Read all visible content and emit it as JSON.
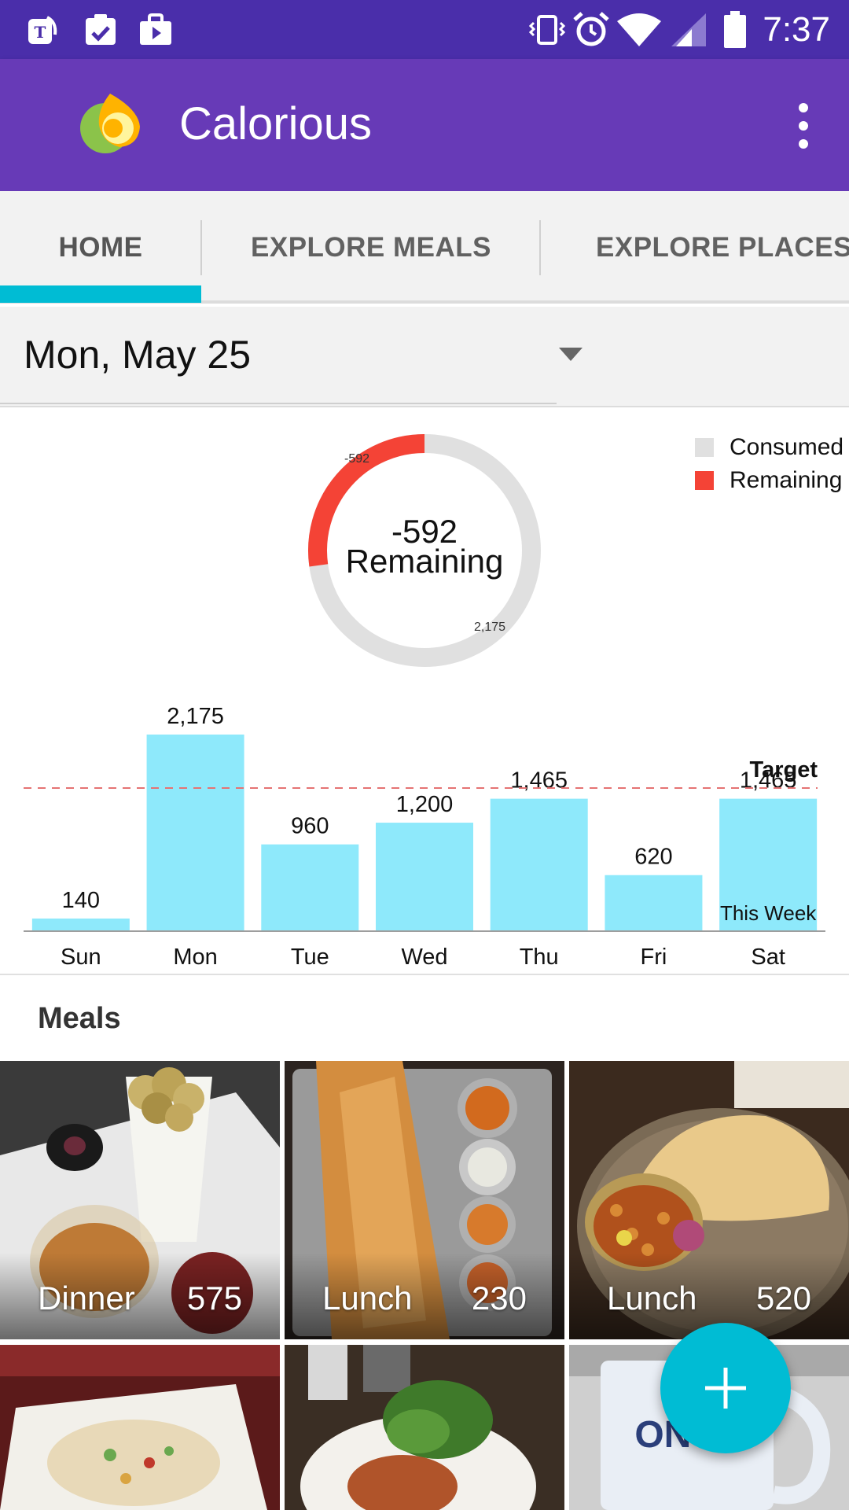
{
  "status_bar": {
    "time": "7:37",
    "left_icons": [
      "tmobile-icon",
      "clipboard-check-icon",
      "play-bag-icon"
    ],
    "right_icons": [
      "vibrate-icon",
      "alarm-icon",
      "wifi-icon",
      "signal-icon",
      "battery-icon"
    ]
  },
  "app_bar": {
    "title": "Calorious",
    "logo_icon": "calorious-logo-icon",
    "menu_icon": "overflow-menu-icon"
  },
  "tabs": [
    {
      "label": "HOME",
      "selected": true
    },
    {
      "label": "EXPLORE MEALS",
      "selected": false
    },
    {
      "label": "EXPLORE PLACES",
      "selected": false
    }
  ],
  "date_selector": {
    "value": "Mon, May 25"
  },
  "colors": {
    "status_bar": "#4a2eaa",
    "app_bar": "#673ab7",
    "accent": "#00bcd4",
    "bar": "#8ee9fb",
    "consumed": "#e0e0e0",
    "remaining": "#f44336"
  },
  "donut": {
    "center_value": "-592",
    "center_label": "Remaining",
    "remaining_label": "-592",
    "consumed_label": "2,175",
    "legend": [
      {
        "label": "Consumed",
        "color": "#e0e0e0"
      },
      {
        "label": "Remaining",
        "color": "#f44336"
      }
    ]
  },
  "chart_data": [
    {
      "type": "pie",
      "labels": [
        "Consumed",
        "Remaining"
      ],
      "values": [
        2175,
        592
      ],
      "annotations": [
        "-592",
        "2,175"
      ]
    },
    {
      "type": "bar",
      "categories": [
        "Sun",
        "Mon",
        "Tue",
        "Wed",
        "Thu",
        "Fri",
        "Sat"
      ],
      "values": [
        140,
        2175,
        960,
        1200,
        1465,
        620,
        1465
      ],
      "value_labels": [
        "140",
        "2,175",
        "960",
        "1,200",
        "1,465",
        "620",
        "1,465"
      ],
      "target_value": 1583,
      "target_label": "Target",
      "series_label": "This Week",
      "ylim": [
        0,
        2175
      ],
      "grid": false
    }
  ],
  "meals": {
    "title": "Meals",
    "items": [
      {
        "name": "Dinner",
        "calories": "575"
      },
      {
        "name": "Lunch",
        "calories": "230"
      },
      {
        "name": "Lunch",
        "calories": "520"
      },
      {
        "name": "",
        "calories": ""
      },
      {
        "name": "",
        "calories": ""
      },
      {
        "name": "",
        "calories": ""
      }
    ]
  },
  "fab": {
    "icon": "plus-icon"
  }
}
